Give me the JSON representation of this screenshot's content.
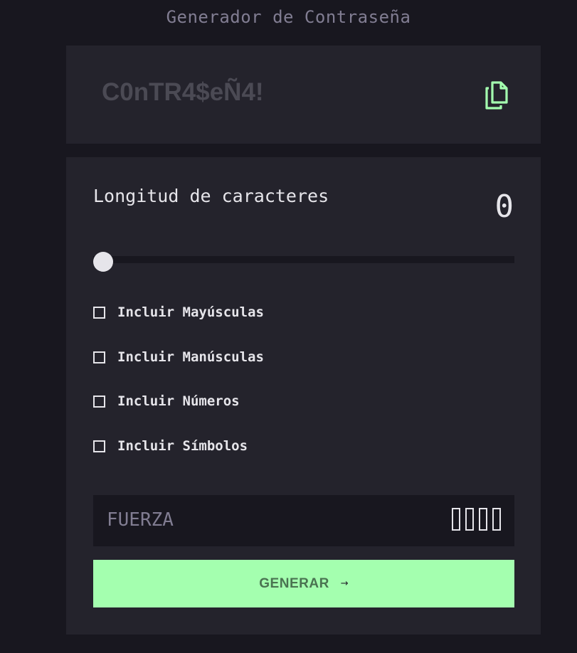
{
  "app": {
    "title": "Generador de Contraseña"
  },
  "password": {
    "value": "C0nTR4$eÑ4!",
    "copy_icon": "copy-icon"
  },
  "length": {
    "label": "Longitud de caracteres",
    "value": "0",
    "slider_fraction": 0
  },
  "options": [
    {
      "label": "Incluir Mayúsculas",
      "checked": false
    },
    {
      "label": "Incluir Manúsculas",
      "checked": false
    },
    {
      "label": "Incluir Números",
      "checked": false
    },
    {
      "label": "Incluir Símbolos",
      "checked": false
    }
  ],
  "strength": {
    "label": "FUERZA",
    "filled_bars": 0,
    "total_bars": 4
  },
  "generate": {
    "label": "GENERAR",
    "icon": "arrow-right-icon"
  },
  "colors": {
    "background": "#18171f",
    "panel": "#24232c",
    "accent": "#a4ffaf",
    "text": "#e6e5ea",
    "muted": "#817d92"
  }
}
